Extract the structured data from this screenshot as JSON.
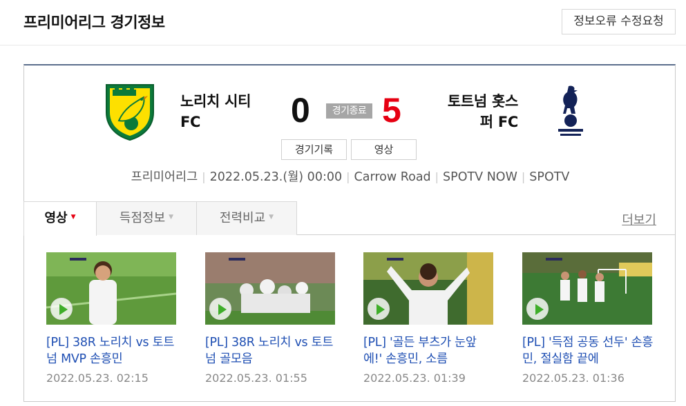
{
  "header": {
    "title": "프리미어리그 경기정보",
    "report_button": "정보오류 수정요청"
  },
  "match": {
    "home": {
      "name_line1": "노리치 시티",
      "name_line2": "FC",
      "score": "0",
      "crest_icon": "norwich-city-crest"
    },
    "away": {
      "name_line1": "토트넘 홋스",
      "name_line2": "퍼 FC",
      "score": "5",
      "crest_icon": "tottenham-hotspur-crest"
    },
    "status": "경기종료",
    "buttons": {
      "record": "경기기록",
      "video": "영상"
    },
    "info": {
      "league": "프리미어리그",
      "datetime": "2022.05.23.(월) 00:00",
      "stadium": "Carrow Road",
      "broadcast1": "SPOTV NOW",
      "broadcast2": "SPOTV"
    }
  },
  "tabs": [
    {
      "label": "영상"
    },
    {
      "label": "득점정보"
    },
    {
      "label": "전력비교"
    }
  ],
  "more_link": "더보기",
  "videos": [
    {
      "title": "[PL] 38R 노리치 vs 토트넘 MVP 손흥민",
      "date": "2022.05.23. 02:15"
    },
    {
      "title": "[PL] 38R 노리치 vs 토트넘 골모음",
      "date": "2022.05.23. 01:55"
    },
    {
      "title": "[PL] '골든 부츠가 눈앞에!' 손흥민, 소름",
      "date": "2022.05.23. 01:39"
    },
    {
      "title": "[PL] '득점 공동 선두' 손흥민, 절실함 끝에",
      "date": "2022.05.23. 01:36"
    }
  ],
  "colors": {
    "away_score": "#e60012",
    "link": "#1f4fb3",
    "card_top_border": "#5b6e8c",
    "status_badge": "#a6a6a6"
  }
}
